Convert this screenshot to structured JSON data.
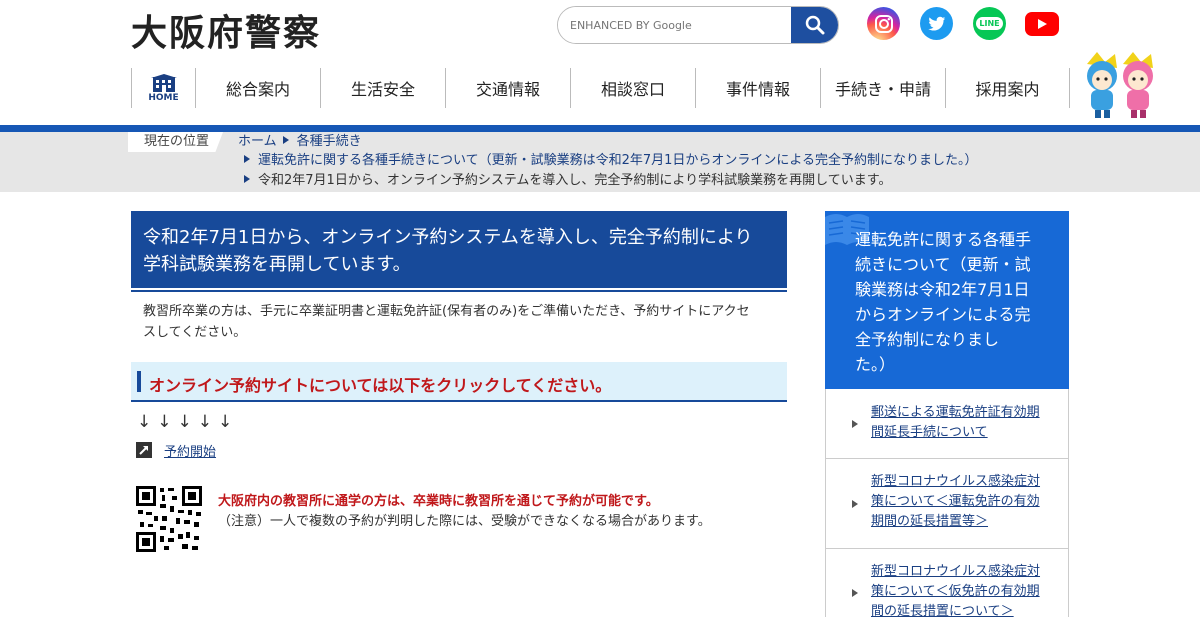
{
  "header": {
    "logo_text": "大阪府警察",
    "search": {
      "placeholder": "ENHANCED BY Google"
    },
    "sns": {
      "instagram": "instagram-icon",
      "twitter": "twitter-icon",
      "line_label": "LINE",
      "youtube": "youtube-icon"
    },
    "nav": {
      "home_label": "HOME",
      "items": [
        "総合案内",
        "生活安全",
        "交通情報",
        "相談窓口",
        "事件情報",
        "手続き・申請",
        "採用案内"
      ]
    }
  },
  "breadcrumb": {
    "label": "現在の位置",
    "row1": [
      "ホーム",
      "各種手続き"
    ],
    "row2": "運転免許に関する各種手続きについて（更新・試験業務は令和2年7月1日からオンラインによる完全予約制になりました。）",
    "row3": "令和2年7月1日から、オンライン予約システムを導入し、完全予約制により学科試験業務を再開しています。"
  },
  "main": {
    "title_line1": "令和2年7月1日から、オンライン予約システムを導入し、完全予約制により",
    "title_line2": "学科試験業務を再開しています。",
    "intro_line1": "教習所卒業の方は、手元に卒業証明書と運転免許証(保有者のみ)をご準備いただき、予約サイトにアクセ",
    "intro_line2": "スしてください。",
    "sub_heading": "オンライン予約サイトについては以下をクリックしてください。",
    "arrows": "↓↓↓↓↓",
    "reserve_link": "予約開始",
    "notice_red": "大阪府内の教習所に通学の方は、卒業時に教習所を通じて予約が可能です。",
    "notice_note": "（注意）一人で複数の予約が判明した際には、受験ができなくなる場合があります。"
  },
  "sidebar": {
    "heading_lines": [
      "運転免許に関する各種手",
      "続きについて（更新・試",
      "験業務は令和2年7月1日",
      "からオンラインによる完",
      "全予約制になりまし",
      "た。）"
    ],
    "items": [
      {
        "lines": [
          "郵送による運転免許証有効期",
          "間延長手続について"
        ]
      },
      {
        "lines": [
          "新型コロナウイルス感染症対",
          "策について＜運転免許の有効",
          "期間の延長措置等＞"
        ]
      },
      {
        "lines": [
          "新型コロナウイルス感染症対",
          "策について＜仮免許の有効期",
          "間の延長措置について＞"
        ]
      }
    ]
  },
  "colors": {
    "brand_blue": "#174a9a",
    "accent_red": "#c0181b",
    "side_blue": "#1769d6"
  }
}
